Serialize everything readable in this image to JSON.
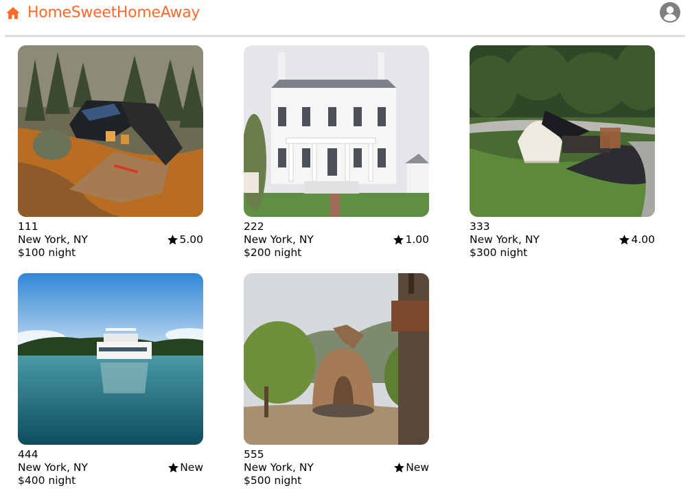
{
  "header": {
    "brand": "HomeSweetHomeAway",
    "brand_color": "#ff6a2b",
    "home_icon": "home-icon",
    "profile_icon": "user-circle-icon"
  },
  "listings": [
    {
      "name": "111",
      "location": "New York, NY",
      "price": "$100 night",
      "rating": "5.00",
      "photo": "a-frame cabin in forest"
    },
    {
      "name": "222",
      "location": "New York, NY",
      "price": "$200 night",
      "rating": "1.00",
      "photo": "white colonial house"
    },
    {
      "name": "333",
      "location": "New York, NY",
      "price": "$300 night",
      "rating": "4.00",
      "photo": "geodesic dome on hillside"
    },
    {
      "name": "444",
      "location": "New York, NY",
      "price": "$400 night",
      "rating": "New",
      "photo": "houseboat on lake"
    },
    {
      "name": "555",
      "location": "New York, NY",
      "price": "$500 night",
      "rating": "New",
      "photo": "earth house in canyon"
    }
  ]
}
